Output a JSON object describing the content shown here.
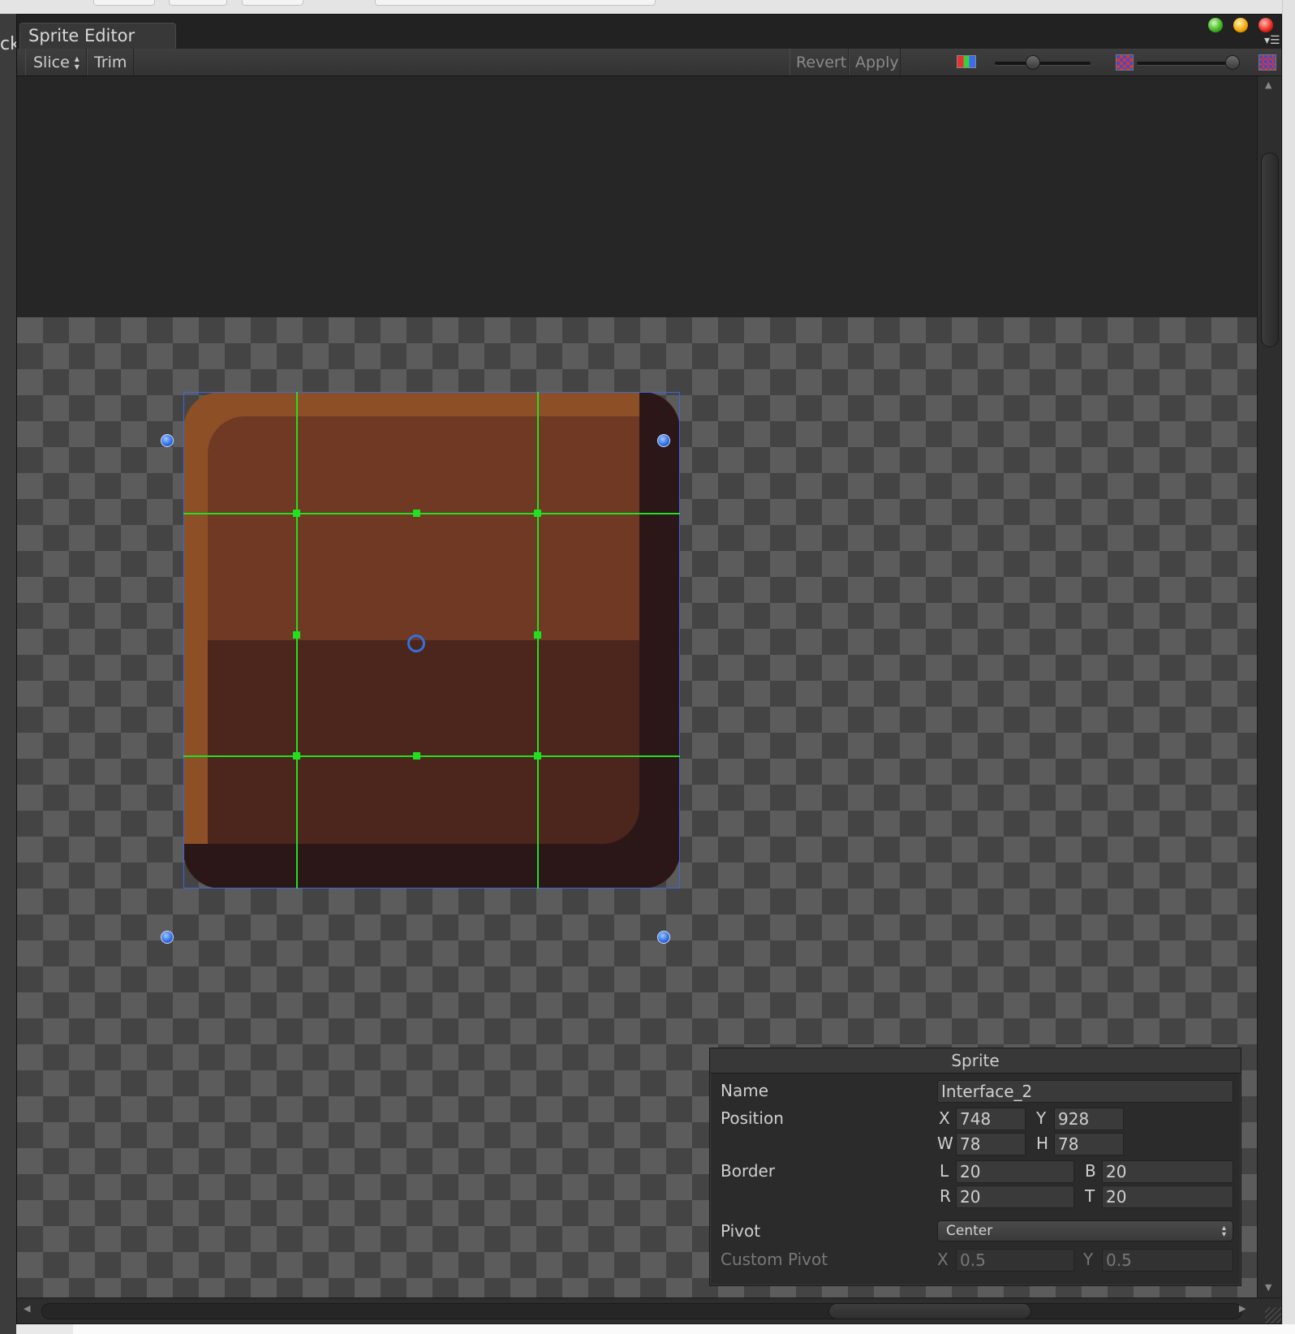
{
  "background": {
    "left_fragment": "ck"
  },
  "window": {
    "tab_title": "Sprite Editor",
    "traffic_lights": [
      "green",
      "yellow",
      "red"
    ],
    "menu_icon": "window-menu-icon"
  },
  "toolbar": {
    "slice_label": "Slice",
    "trim_label": "Trim",
    "revert_label": "Revert",
    "apply_label": "Apply",
    "color_channel_icon": "rgb-channels-icon",
    "zoom_slider_value": 0.4,
    "mip_slider_value": 1.0,
    "mip_small_icon": "mipmap-low-icon",
    "mip_large_icon": "mipmap-high-icon"
  },
  "sprite_panel": {
    "title": "Sprite",
    "name_label": "Name",
    "name_value": "Interface_2",
    "position_label": "Position",
    "x_label": "X",
    "x_value": "748",
    "y_label": "Y",
    "y_value": "928",
    "w_label": "W",
    "w_value": "78",
    "h_label": "H",
    "h_value": "78",
    "border_label": "Border",
    "l_label": "L",
    "l_value": "20",
    "b_label": "B",
    "b_value": "20",
    "r_label": "R",
    "r_value": "20",
    "t_label": "T",
    "t_value": "20",
    "pivot_label": "Pivot",
    "pivot_value": "Center",
    "custom_pivot_label": "Custom Pivot",
    "cpx_label": "X",
    "cpx_value": "0.5",
    "cpy_label": "Y",
    "cpy_value": "0.5"
  },
  "colors": {
    "selection_outline": "#3a68d8",
    "border_guides": "#22e022",
    "sprite_top": "#6f3924",
    "sprite_bottom": "#4c261c"
  }
}
